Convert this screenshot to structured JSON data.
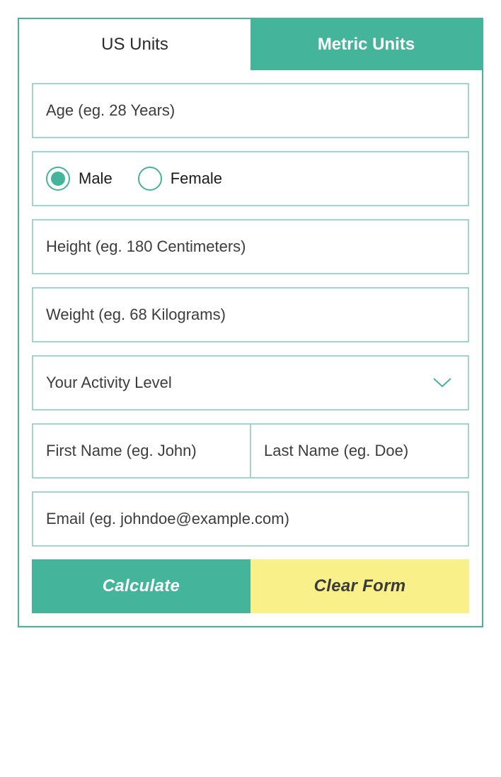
{
  "tabs": {
    "us": "US Units",
    "metric": "Metric Units",
    "active": "metric"
  },
  "fields": {
    "age": {
      "placeholder": "Age (eg. 28 Years)",
      "value": ""
    },
    "gender": {
      "options": {
        "male": "Male",
        "female": "Female"
      },
      "selected": "male"
    },
    "height": {
      "placeholder": "Height (eg. 180 Centimeters)",
      "value": ""
    },
    "weight": {
      "placeholder": "Weight (eg. 68 Kilograms)",
      "value": ""
    },
    "activity": {
      "placeholder": "Your Activity Level",
      "value": ""
    },
    "first_name": {
      "placeholder": "First Name (eg. John)",
      "value": ""
    },
    "last_name": {
      "placeholder": "Last Name (eg. Doe)",
      "value": ""
    },
    "email": {
      "placeholder": "Email (eg. johndoe@example.com)",
      "value": ""
    }
  },
  "buttons": {
    "calculate": "Calculate",
    "clear": "Clear Form"
  },
  "colors": {
    "primary": "#44b49a",
    "border": "#9fd7c8",
    "yellow": "#f9f08a"
  }
}
